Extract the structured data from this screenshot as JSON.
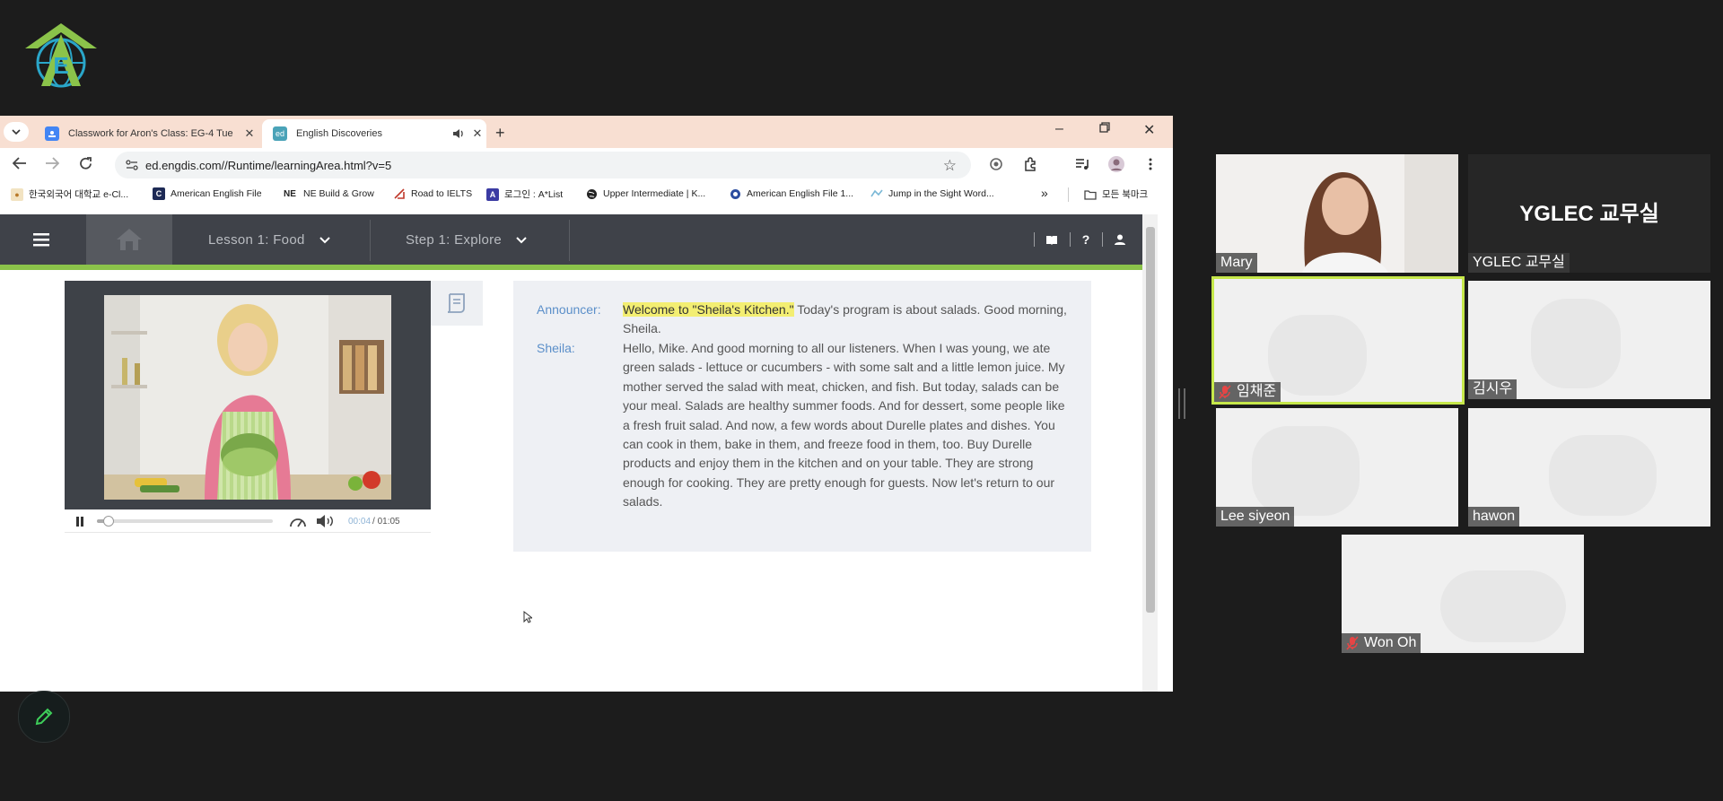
{
  "browser": {
    "tabs": [
      {
        "title": "Classwork for Aron's Class: EG-4 Tue",
        "favicon": "classroom-icon",
        "active": false
      },
      {
        "title": "English Discoveries",
        "favicon": "ed-icon",
        "favicon_text": "ed",
        "active": true
      }
    ],
    "url": "ed.engdis.com//Runtime/learningArea.html?v=5",
    "bookmarks": [
      {
        "label": "한국외국어 대학교 e-Cl...",
        "icon": "hufs-icon"
      },
      {
        "label": "American English File",
        "icon": "aef-icon",
        "icon_text": "C"
      },
      {
        "label": "NE Build & Grow",
        "icon": "ne-icon",
        "icon_text": "NE"
      },
      {
        "label": "Road to IELTS",
        "icon": "ielts-icon"
      },
      {
        "label": "로그인 : A*List",
        "icon": "alist-icon",
        "icon_text": "A"
      },
      {
        "label": "Upper Intermediate | K...",
        "icon": "globe-icon"
      },
      {
        "label": "American English File 1...",
        "icon": "aef2-icon"
      },
      {
        "label": "Jump in the Sight Word...",
        "icon": "jump-icon"
      }
    ],
    "more_bookmarks": "»",
    "all_bookmarks": "모든 북마크"
  },
  "app": {
    "lesson": "Lesson 1: Food",
    "step": "Step 1: Explore",
    "player": {
      "current": "00:04",
      "total": "/ 01:05",
      "progress": 0.06
    }
  },
  "transcript": [
    {
      "speaker": "Announcer:",
      "highlight": "Welcome to \"Sheila's Kitchen.\"",
      "text": " Today's program is about salads. Good morning, Sheila."
    },
    {
      "speaker": "Sheila:",
      "highlight": "",
      "text": "Hello, Mike. And good morning to all our listeners. When I was young, we ate green salads - lettuce or cucumbers - with some salt and a little lemon juice. My mother served the salad with meat, chicken, and fish. But today, salads can be your meal. Salads are healthy summer foods. And for dessert, some people like a fresh fruit salad. And now, a few words about Durelle plates and dishes. You can cook in them, bake in them, and freeze food in them, too. Buy Durelle products and enjoy them in the kitchen and on your table. They are strong enough for cooking. They are pretty enough for guests. Now let's return to our salads."
    }
  ],
  "participants": [
    {
      "name": "Mary",
      "muted": false
    },
    {
      "name": "YGLEC 교무실",
      "display": "YGLEC 교무실",
      "muted": false
    },
    {
      "name": "임채준",
      "muted": true
    },
    {
      "name": "김시우",
      "muted": false
    },
    {
      "name": "Lee siyeon",
      "muted": false
    },
    {
      "name": "hawon",
      "muted": false
    },
    {
      "name": "Won Oh",
      "muted": true
    }
  ],
  "colors": {
    "accent": "#8bc34a",
    "highlight": "#f3ee72",
    "speaker": "#5b8fc9",
    "active_speaker": "#c6e84a"
  }
}
